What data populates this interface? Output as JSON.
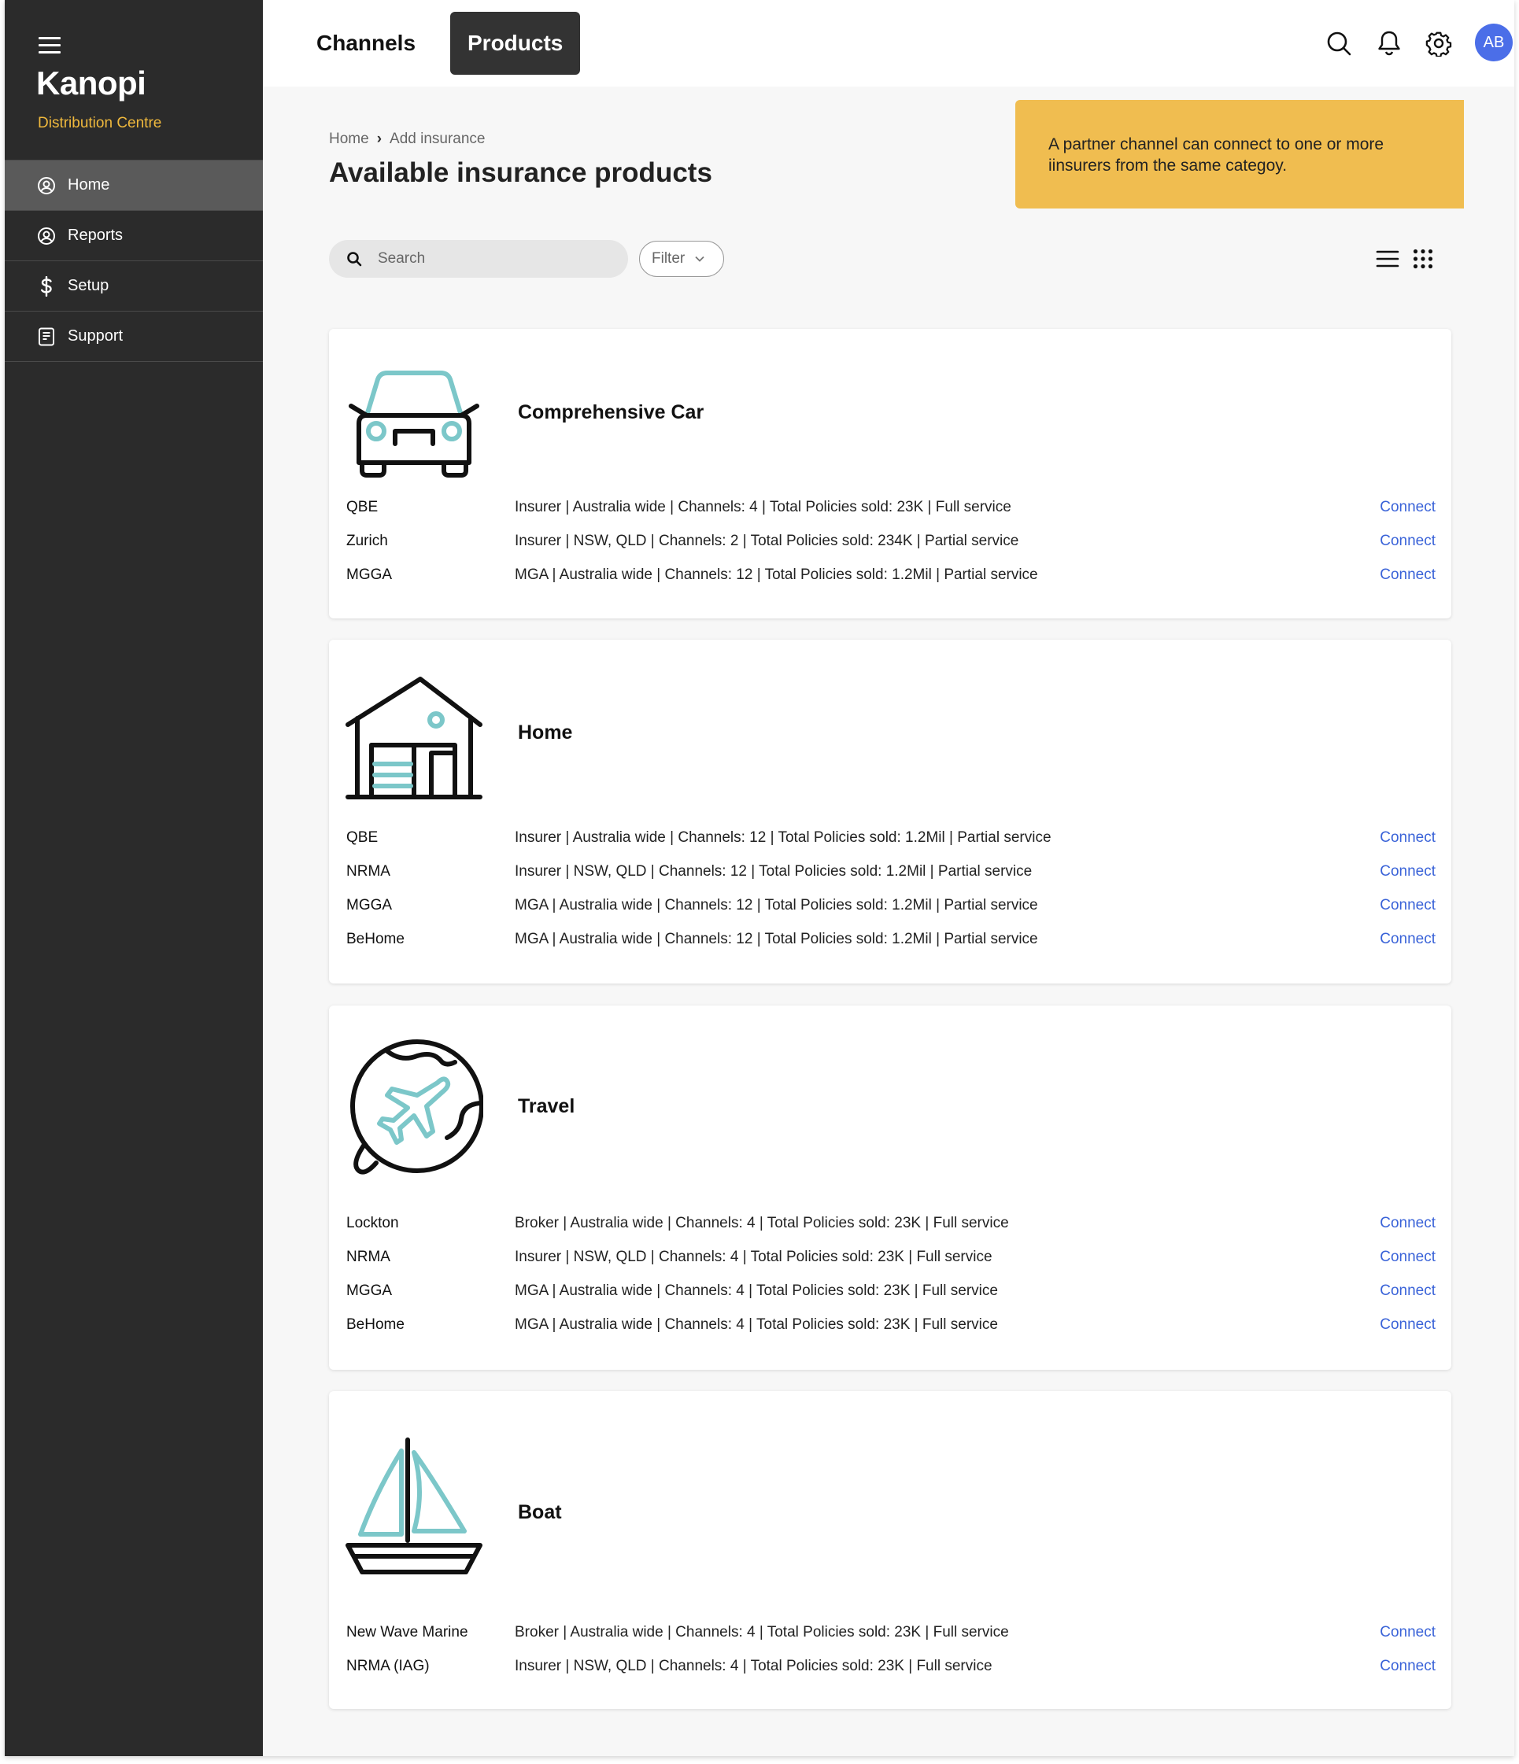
{
  "sidebar": {
    "brand": "Kanopi",
    "subtitle": "Distribution Centre",
    "items": [
      {
        "label": "Home",
        "icon": "user-circle-icon",
        "active": true
      },
      {
        "label": "Reports",
        "icon": "user-circle-icon",
        "active": false
      },
      {
        "label": "Setup",
        "icon": "dollar-icon",
        "active": false
      },
      {
        "label": "Support",
        "icon": "document-icon",
        "active": false
      }
    ]
  },
  "topbar": {
    "tabs": [
      {
        "label": "Channels",
        "active": false
      },
      {
        "label": "Products",
        "active": true
      }
    ],
    "avatar": "AB"
  },
  "breadcrumb": {
    "home": "Home",
    "current": "Add insurance"
  },
  "title": "Available insurance products",
  "callout": "A partner channel can connect to one or more iinsurers from the same categoy.",
  "search": {
    "placeholder": "Search"
  },
  "filter": {
    "label": "Filter"
  },
  "colors": {
    "accent": "#3a63d8",
    "brand": "#f0b93d",
    "callout": "#f0bd50",
    "icon_teal": "#79c4c6",
    "sidebar": "#2b2b2b"
  },
  "products": [
    {
      "title": "Comprehensive Car",
      "icon": "car-icon",
      "rows": [
        {
          "name": "QBE",
          "desc": "Insurer | Australia wide | Channels: 4 | Total Policies sold: 23K | Full service",
          "action": "Connect"
        },
        {
          "name": "Zurich",
          "desc": "Insurer | NSW, QLD | Channels: 2 | Total Policies sold: 234K | Partial service",
          "action": "Connect"
        },
        {
          "name": "MGGA",
          "desc": "MGA | Australia wide | Channels: 12 | Total Policies sold: 1.2Mil | Partial service",
          "action": "Connect"
        }
      ]
    },
    {
      "title": "Home",
      "icon": "house-icon",
      "rows": [
        {
          "name": "QBE",
          "desc": "Insurer | Australia wide | Channels: 12 | Total Policies sold: 1.2Mil | Partial service",
          "action": "Connect"
        },
        {
          "name": "NRMA",
          "desc": "Insurer | NSW, QLD | Channels: 12 | Total Policies sold: 1.2Mil | Partial service",
          "action": "Connect"
        },
        {
          "name": "MGGA",
          "desc": "MGA | Australia wide | Channels: 12 | Total Policies sold: 1.2Mil | Partial service",
          "action": "Connect"
        },
        {
          "name": "BeHome",
          "desc": "MGA | Australia wide | Channels: 12 | Total Policies sold: 1.2Mil | Partial service",
          "action": "Connect"
        }
      ]
    },
    {
      "title": "Travel",
      "icon": "globe-plane-icon",
      "rows": [
        {
          "name": "Lockton",
          "desc": "Broker | Australia wide | Channels: 4 | Total Policies sold: 23K | Full service",
          "action": "Connect"
        },
        {
          "name": "NRMA",
          "desc": "Insurer | NSW, QLD | Channels: 4 | Total Policies sold: 23K | Full service",
          "action": "Connect"
        },
        {
          "name": "MGGA",
          "desc": "MGA | Australia wide | Channels: 4 | Total Policies sold: 23K | Full service",
          "action": "Connect"
        },
        {
          "name": "BeHome",
          "desc": "MGA | Australia wide | Channels: 4 | Total Policies sold: 23K | Full service",
          "action": "Connect"
        }
      ]
    },
    {
      "title": "Boat",
      "icon": "sailboat-icon",
      "rows": [
        {
          "name": "New Wave Marine",
          "desc": "Broker | Australia wide | Channels: 4 | Total Policies sold: 23K | Full service",
          "action": "Connect"
        },
        {
          "name": "NRMA (IAG)",
          "desc": "Insurer | NSW, QLD | Channels: 4 | Total Policies sold: 23K | Full service",
          "action": "Connect"
        }
      ]
    }
  ]
}
